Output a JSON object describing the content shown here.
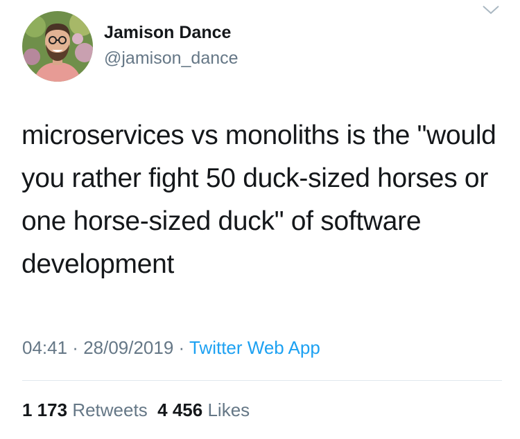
{
  "user": {
    "name": "Jamison Dance",
    "handle": "@jamison_dance"
  },
  "tweet": {
    "text": "microservices vs monoliths is the \"would you rather fight 50 duck-sized horses or one horse-sized duck\" of software development"
  },
  "meta": {
    "time": "04:41",
    "separator1": " · ",
    "date": "28/09/2019",
    "separator2": " · ",
    "source": "Twitter Web App"
  },
  "stats": {
    "retweets_count": "1 173",
    "retweets_label": "Retweets",
    "likes_count": "4 456",
    "likes_label": "Likes"
  },
  "colors": {
    "text": "#14171a",
    "secondary": "#657786",
    "link": "#1da1f2",
    "divider": "#e1e8ed"
  },
  "icons": {
    "menu": "chevron-down-icon"
  }
}
